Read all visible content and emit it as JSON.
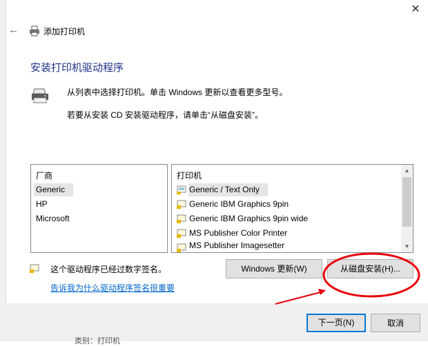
{
  "window": {
    "close_glyph": "✕",
    "back_glyph": "←",
    "title": "添加打印机"
  },
  "heading": "安装打印机驱动程序",
  "description": {
    "line1": "从列表中选择打印机。单击 Windows 更新以查看更多型号。",
    "line2": "若要从安装 CD 安装驱动程序，请单击“从磁盘安装”。"
  },
  "manufacturers": {
    "header": "厂商",
    "items": [
      "Generic",
      "HP",
      "Microsoft"
    ],
    "selected": "Generic"
  },
  "printers": {
    "header": "打印机",
    "items": [
      "Generic / Text Only",
      "Generic IBM Graphics 9pin",
      "Generic IBM Graphics 9pin wide",
      "MS Publisher Color Printer",
      "MS Publisher Imagesetter"
    ],
    "selected": "Generic / Text Only"
  },
  "buttons": {
    "windows_update": "Windows 更新(W)",
    "have_disk": "从磁盘安装(H)...",
    "next": "下一页(N)",
    "cancel": "取消"
  },
  "signature": {
    "text": "这个驱动程序已经过数字签名。",
    "link": "告诉我为什么驱动程序签名很重要"
  },
  "background": {
    "text": "类别：打印机"
  },
  "colors": {
    "accent": "#0078d7",
    "heading": "#1e3287",
    "link": "#0066cc",
    "annotation": "#e8000b"
  }
}
